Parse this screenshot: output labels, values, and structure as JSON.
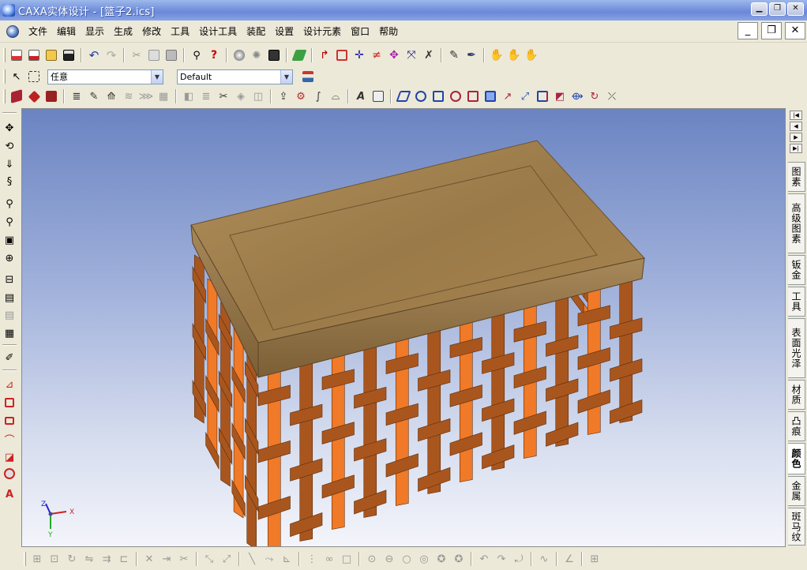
{
  "window": {
    "title": "CAXA实体设计 - [篮子2.ics]"
  },
  "menu": [
    "文件",
    "编辑",
    "显示",
    "生成",
    "修改",
    "工具",
    "设计工具",
    "装配",
    "设置",
    "设计元素",
    "窗口",
    "帮助"
  ],
  "toolbar": {
    "filter_combo": "任意",
    "config_combo": "Default"
  },
  "right_tabs": [
    "图素",
    "高级图素",
    "钣金",
    "工具",
    "表面光泽",
    "材质",
    "凸痕",
    "颜色",
    "金属",
    "斑马纹"
  ],
  "active_tab": "颜色",
  "axes": {
    "x": "X",
    "y": "Y",
    "z": "Z"
  },
  "colors": {
    "rim_wood": "#9a7a48",
    "weave_orange": "#f07a28",
    "weave_brown": "#a9561e",
    "viewport_top": "#6b84c2",
    "viewport_bottom": "#f4f5fb"
  },
  "icons": {
    "std_toolbar": [
      "new-icon",
      "new-drawing-icon",
      "open-icon",
      "save-icon",
      "undo-icon",
      "redo-icon",
      "cut-icon",
      "copy-icon",
      "paste-icon",
      "search-icon",
      "help-icon",
      "render-icon",
      "lights-icon",
      "print-icon",
      "green-plane-icon",
      "arrow-icon",
      "box-icon",
      "axis-icon",
      "triad-icon",
      "move-icon",
      "scale-icon",
      "cross-icon",
      "pen-icon",
      "eyedropper-icon",
      "grab-icon",
      "rotate-icon",
      "tool-icon"
    ],
    "left_toolbar": [
      "move-view-icon",
      "rotate-view-icon",
      "walk-icon",
      "spin-icon",
      "zoom-icon",
      "zoom-area-icon",
      "camera-icon",
      "target-icon",
      "tool-a-icon",
      "camera-b-icon",
      "camera-c-icon",
      "camera-d-icon",
      "paint-icon",
      "sketch-icon",
      "rect-icon",
      "rect2-icon",
      "curve-icon",
      "edit-icon",
      "sphere-icon",
      "text-icon"
    ]
  }
}
